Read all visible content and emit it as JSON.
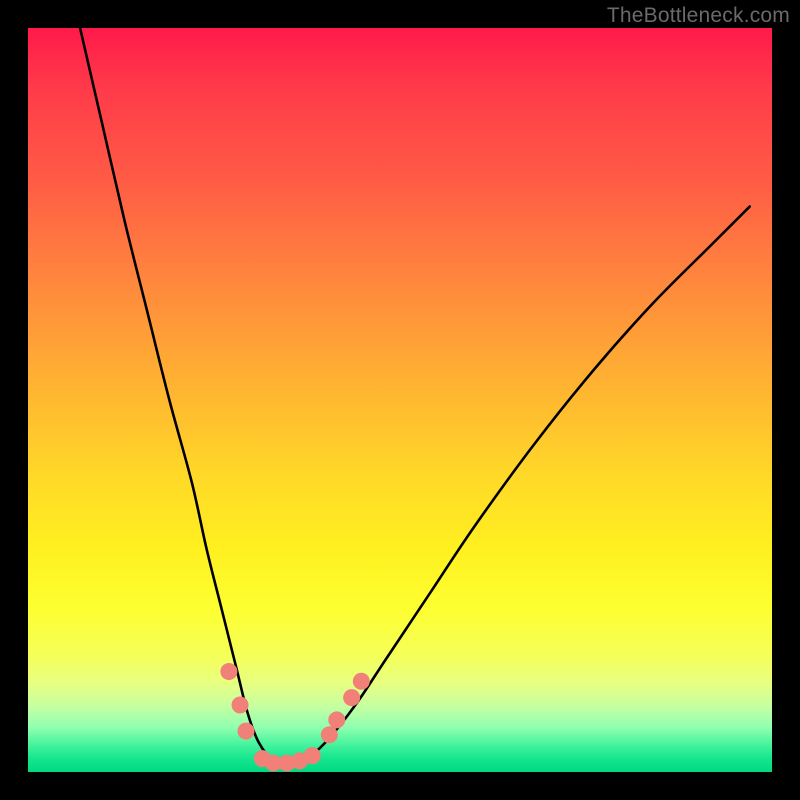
{
  "watermark": "TheBottleneck.com",
  "chart_data": {
    "type": "line",
    "title": "",
    "xlabel": "",
    "ylabel": "",
    "xlim": [
      0,
      100
    ],
    "ylim": [
      0,
      100
    ],
    "grid": false,
    "series": [
      {
        "name": "curve",
        "color": "#000000",
        "x": [
          7,
          10,
          13,
          16,
          19,
          22,
          24,
          26,
          28,
          29.5,
          31,
          33,
          35,
          37,
          40,
          44,
          48,
          54,
          60,
          68,
          76,
          84,
          92,
          97
        ],
        "y": [
          100,
          87,
          74,
          62,
          50,
          39,
          30,
          22,
          14,
          8,
          4,
          1.5,
          1,
          1.5,
          4,
          9,
          15,
          24,
          33,
          44,
          54,
          63,
          71,
          76
        ]
      }
    ],
    "markers": [
      {
        "x": 27,
        "y": 13.5
      },
      {
        "x": 28.5,
        "y": 9
      },
      {
        "x": 29.3,
        "y": 5.5
      },
      {
        "x": 31.5,
        "y": 1.8
      },
      {
        "x": 33,
        "y": 1.2
      },
      {
        "x": 34.8,
        "y": 1.2
      },
      {
        "x": 36.5,
        "y": 1.5
      },
      {
        "x": 38.2,
        "y": 2.2
      },
      {
        "x": 40.5,
        "y": 5
      },
      {
        "x": 41.5,
        "y": 7
      },
      {
        "x": 43.5,
        "y": 10
      },
      {
        "x": 44.8,
        "y": 12.2
      }
    ],
    "marker_color": "#f08078",
    "gradient_stops": [
      {
        "pos": 0,
        "color": "#ff1a4a"
      },
      {
        "pos": 50,
        "color": "#ffb930"
      },
      {
        "pos": 78,
        "color": "#fdff30"
      },
      {
        "pos": 100,
        "color": "#00d880"
      }
    ]
  }
}
